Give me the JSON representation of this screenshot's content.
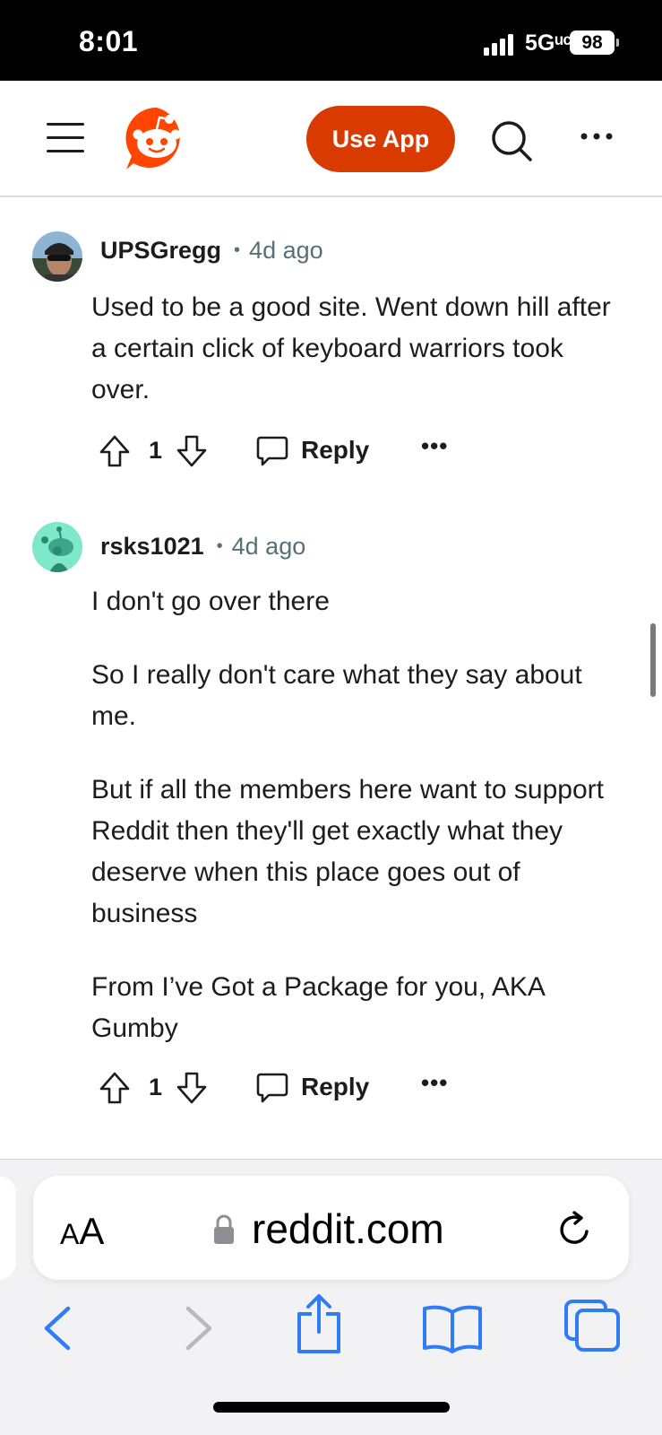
{
  "status_bar": {
    "time": "8:01",
    "network": "5Gᵘᶜ",
    "battery": "98"
  },
  "header": {
    "menu_icon": "hamburger-icon",
    "logo_icon": "reddit-snoo-icon",
    "use_app_label": "Use App",
    "search_icon": "search-icon",
    "more_icon": "more-horizontal-icon",
    "accent_color": "#d93a00"
  },
  "comments": [
    {
      "username": "UPSGregg",
      "separator": "•",
      "time": "4d ago",
      "paragraphs": [
        "Used to be a good site. Went down hill after a certain click of keyboard warriors took over."
      ],
      "votes": "1",
      "reply_label": "Reply",
      "more_label": "•••"
    },
    {
      "username": "rsks1021",
      "separator": "•",
      "time": "4d ago",
      "paragraphs": [
        "I don't go over there",
        "So I really don't care what they say about me.",
        "But if all the members here want to support Reddit then they'll get exactly what they deserve when this place goes out of business",
        "From I’ve Got a Package for you, AKA Gumby"
      ],
      "votes": "1",
      "reply_label": "Reply",
      "more_label": "•••"
    }
  ],
  "safari": {
    "aa_label_big": "A",
    "aa_label_small": "A",
    "url": "reddit.com",
    "tint_color": "#2f7cf6"
  }
}
